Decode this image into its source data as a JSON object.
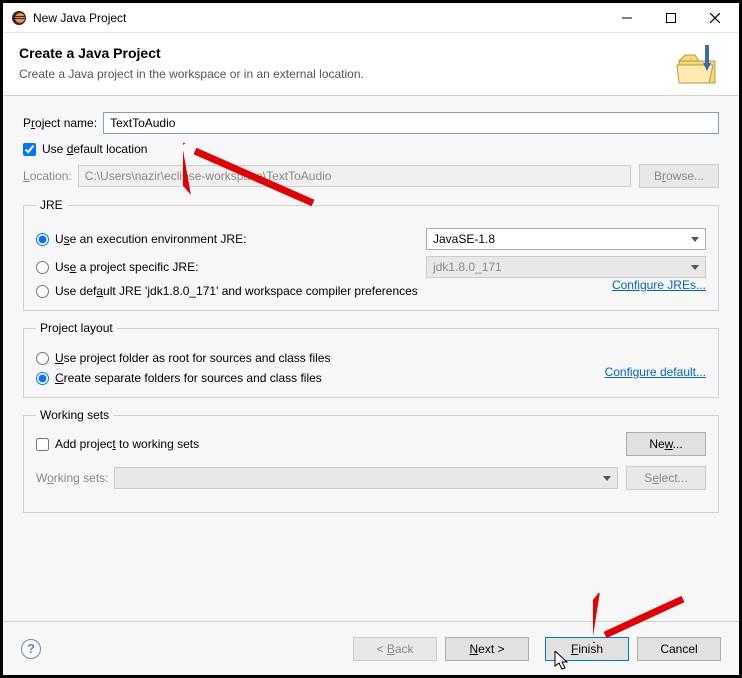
{
  "window": {
    "title": "New Java Project"
  },
  "banner": {
    "title": "Create a Java Project",
    "subtitle": "Create a Java project in the workspace or in an external location."
  },
  "projectName": {
    "label_pre": "P",
    "label_u": "r",
    "label_post": "oject name:",
    "value": "TextToAudio"
  },
  "defaultLocation": {
    "label_pre": "Use ",
    "label_u": "d",
    "label_post": "efault location",
    "checked": true
  },
  "location": {
    "label_pre": "",
    "label_u": "L",
    "label_post": "ocation:",
    "value": "C:\\Users\\nazir\\eclipse-workspace\\TextToAudio",
    "browse_pre": "B",
    "browse_u": "r",
    "browse_post": "owse..."
  },
  "jre": {
    "legend": "JRE",
    "opt1_pre": "U",
    "opt1_u": "s",
    "opt1_post": "e an execution environment JRE:",
    "opt1_value": "JavaSE-1.8",
    "opt2_pre": "Us",
    "opt2_u": "e",
    "opt2_post": " a project specific JRE:",
    "opt2_value": "jdk1.8.0_171",
    "opt3_pre": "Use def",
    "opt3_u": "a",
    "opt3_post": "ult JRE 'jdk1.8.0_171' and workspace compiler preferences",
    "configure_pre": "Configure JR",
    "configure_u": "E",
    "configure_post": "s..."
  },
  "layout": {
    "legend": "Project layout",
    "opt1_pre": "",
    "opt1_u": "U",
    "opt1_post": "se project folder as root for sources and class files",
    "opt2_pre": "",
    "opt2_u": "C",
    "opt2_post": "reate separate folders for sources and class files",
    "configure_pre": "Configure de",
    "configure_u": "f",
    "configure_post": "ault..."
  },
  "workingsets": {
    "legend": "Working sets",
    "add_pre": "Add projec",
    "add_u": "t",
    "add_post": " to working sets",
    "new_pre": "Ne",
    "new_u": "w",
    "new_post": "...",
    "label_pre": "W",
    "label_u": "o",
    "label_post": "rking sets:",
    "select_pre": "S",
    "select_u": "e",
    "select_post": "lect..."
  },
  "footer": {
    "back_pre": "< ",
    "back_u": "B",
    "back_post": "ack",
    "next_pre": "",
    "next_u": "N",
    "next_post": "ext >",
    "finish_pre": "",
    "finish_u": "F",
    "finish_post": "inish",
    "cancel": "Cancel"
  }
}
